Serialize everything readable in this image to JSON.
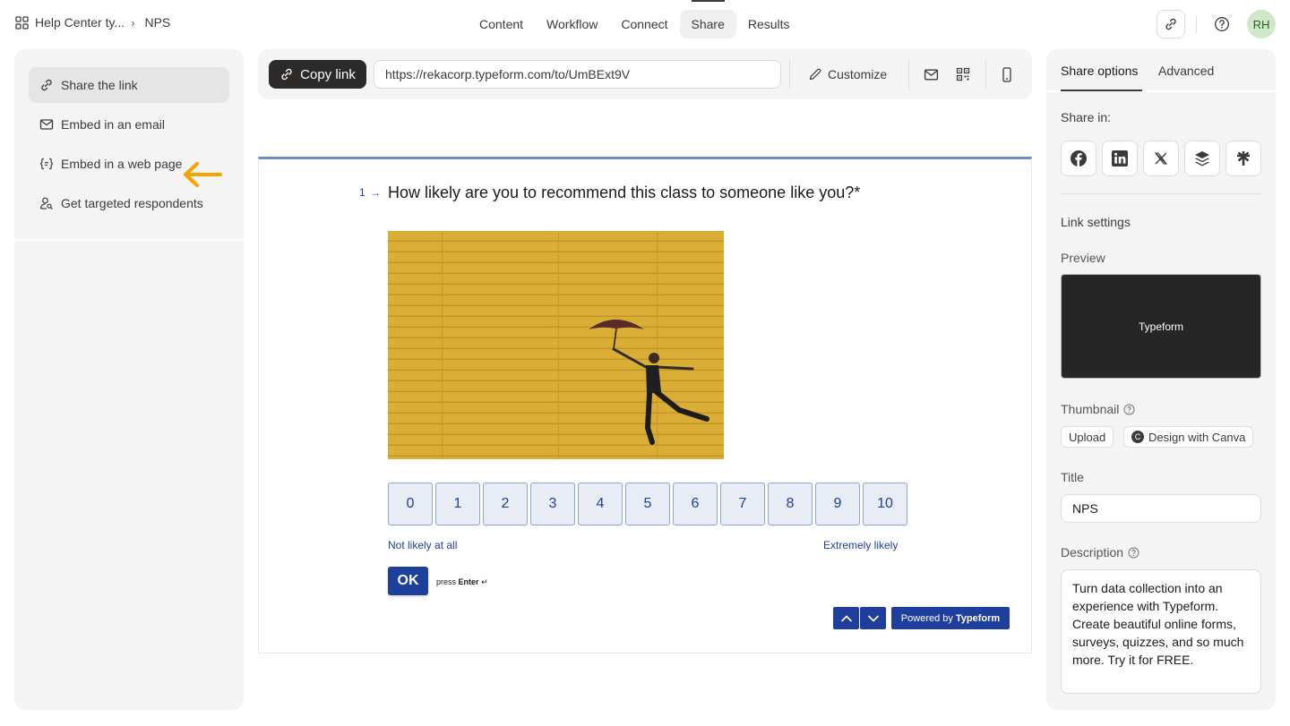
{
  "header": {
    "workspace": "Help Center ty...",
    "form_name": "NPS",
    "tabs": [
      "Content",
      "Workflow",
      "Connect",
      "Share",
      "Results"
    ],
    "active_tab": "Share",
    "avatar_initials": "RH"
  },
  "left_menu": {
    "items": [
      {
        "label": "Share the link",
        "icon": "link-icon",
        "active": true
      },
      {
        "label": "Embed in an email",
        "icon": "mail-icon"
      },
      {
        "label": "Embed in a web page",
        "icon": "code-icon"
      },
      {
        "label": "Get targeted respondents",
        "icon": "person-search-icon"
      }
    ],
    "annotation_color": "#f5a300"
  },
  "share_bar": {
    "copy_label": "Copy link",
    "url": "https://rekacorp.typeform.com/to/UmBExt9V",
    "customize_label": "Customize"
  },
  "form_preview": {
    "question_number": "1",
    "question": "How likely are you to recommend this class to someone like you?*",
    "scale": [
      "0",
      "1",
      "2",
      "3",
      "4",
      "5",
      "6",
      "7",
      "8",
      "9",
      "10"
    ],
    "label_low": "Not likely at all",
    "label_high": "Extremely likely",
    "ok_label": "OK",
    "press_hint_prefix": "press",
    "press_hint_key": "Enter",
    "powered_prefix": "Powered by",
    "powered_brand": "Typeform",
    "accent_color": "#1e3f9c"
  },
  "right_panel": {
    "tabs": [
      "Share options",
      "Advanced"
    ],
    "active_tab": "Share options",
    "share_in_label": "Share in:",
    "social": [
      "facebook-icon",
      "linkedin-icon",
      "x-icon",
      "buffer-icon",
      "linktree-icon"
    ],
    "link_settings_label": "Link settings",
    "preview_label": "Preview",
    "preview_card_text": "Typeform",
    "thumbnail_label": "Thumbnail",
    "upload_label": "Upload",
    "canva_label": "Design with Canva",
    "title_label": "Title",
    "title_value": "NPS",
    "description_label": "Description",
    "description_value": "Turn data collection into an experience with Typeform. Create beautiful online forms, surveys, quizzes, and so much more. Try it for FREE."
  }
}
